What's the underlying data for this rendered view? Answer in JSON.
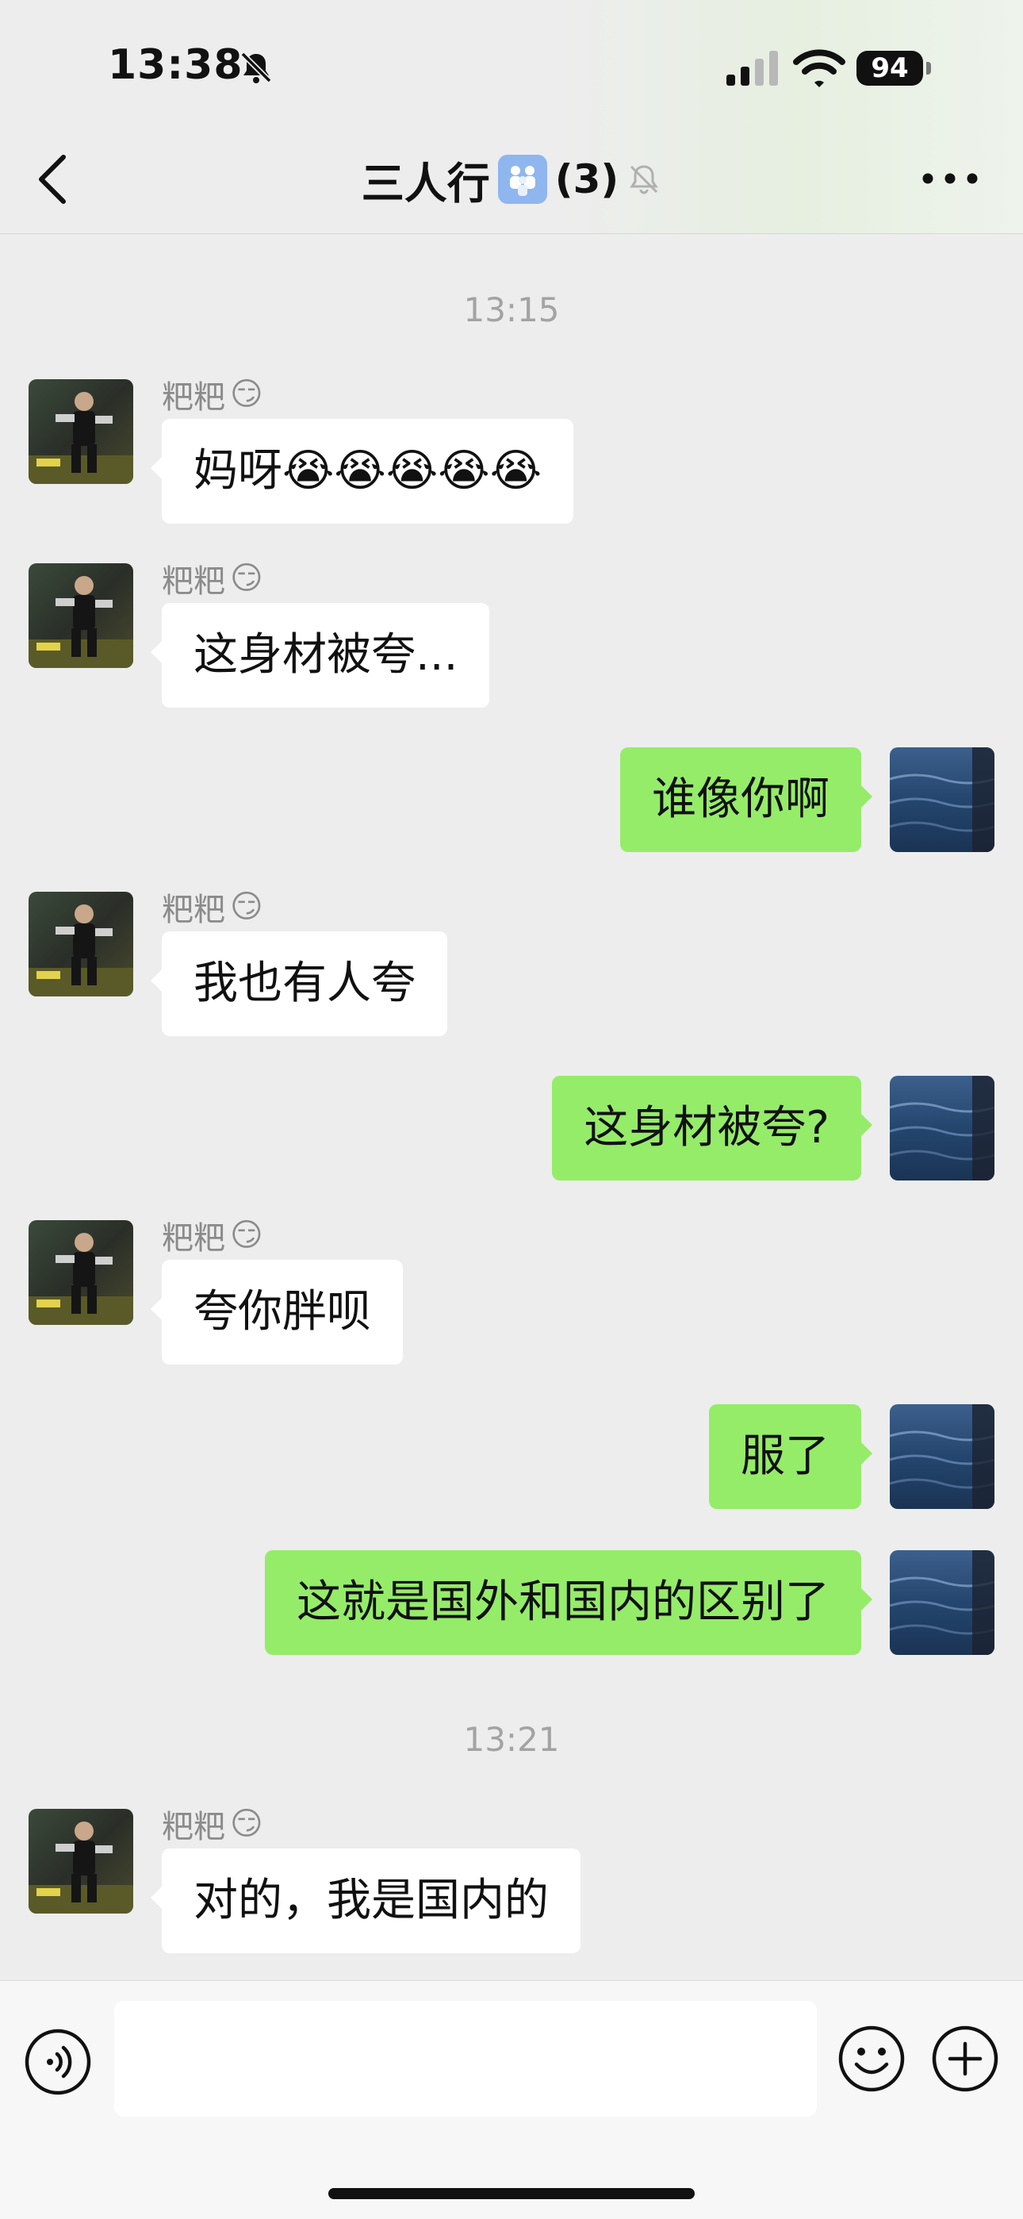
{
  "status": {
    "time": "13:38",
    "battery": "94"
  },
  "nav": {
    "title": "三人行",
    "count": "(3)"
  },
  "timestamps": [
    "13:15",
    "13:21"
  ],
  "messages": [
    {
      "side": "left",
      "sender": "粑粑",
      "text": "妈呀😭😭😭😭😭"
    },
    {
      "side": "left",
      "sender": "粑粑",
      "text": "这身材被夸..."
    },
    {
      "side": "right",
      "text": "谁像你啊"
    },
    {
      "side": "left",
      "sender": "粑粑",
      "text": "我也有人夸"
    },
    {
      "side": "right",
      "text": "这身材被夸?"
    },
    {
      "side": "left",
      "sender": "粑粑",
      "text": "夸你胖呗"
    },
    {
      "side": "right",
      "text": "服了"
    },
    {
      "side": "right",
      "text": "这就是国外和国内的区别了"
    },
    {
      "side": "left",
      "sender": "粑粑",
      "text": "对的，我是国内的"
    }
  ],
  "colors": {
    "self_bubble": "#95ec69",
    "other_bubble": "#ffffff",
    "background": "#ededed"
  },
  "icons": [
    "bell-slash-icon",
    "signal-icon",
    "wifi-icon",
    "back-chevron-icon",
    "group-icon",
    "mute-icon",
    "more-dots-icon",
    "voice-icon",
    "emoji-icon",
    "plus-icon"
  ]
}
